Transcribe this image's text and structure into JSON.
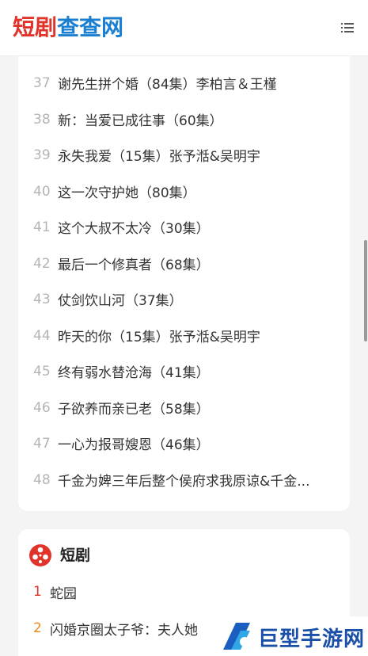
{
  "header": {
    "logo_part1": "短剧",
    "logo_part2": "查查网",
    "menu_icon": "menu-list-icon"
  },
  "list": {
    "items": [
      {
        "num": "37",
        "title": "谢先生拼个婚（84集）李柏言＆王槿"
      },
      {
        "num": "38",
        "title": "新：当爱已成往事（60集）"
      },
      {
        "num": "39",
        "title": "永失我爱（15集）张予湉&吴明宇"
      },
      {
        "num": "40",
        "title": "这一次守护她（80集）"
      },
      {
        "num": "41",
        "title": "这个大叔不太冷（30集）"
      },
      {
        "num": "42",
        "title": "最后一个修真者（68集）"
      },
      {
        "num": "43",
        "title": "仗剑饮山河（37集）"
      },
      {
        "num": "44",
        "title": "昨天的你（15集）张予湉&吴明宇"
      },
      {
        "num": "45",
        "title": "终有弱水替沧海（41集）"
      },
      {
        "num": "46",
        "title": "子欲养而亲已老（58集）"
      },
      {
        "num": "47",
        "title": "一心为报哥嫂恩（46集）"
      },
      {
        "num": "48",
        "title": "千金为婢三年后整个侯府求我原谅&千金..."
      }
    ]
  },
  "section": {
    "title": "短剧",
    "icon": "film-reel-icon",
    "items": [
      {
        "num": "1",
        "title": "蛇园",
        "color": "#e0342b"
      },
      {
        "num": "2",
        "title": "闪婚京圈太子爷：夫人她",
        "color": "#f08a1c"
      }
    ]
  },
  "watermark": {
    "text": "巨型手游网"
  }
}
